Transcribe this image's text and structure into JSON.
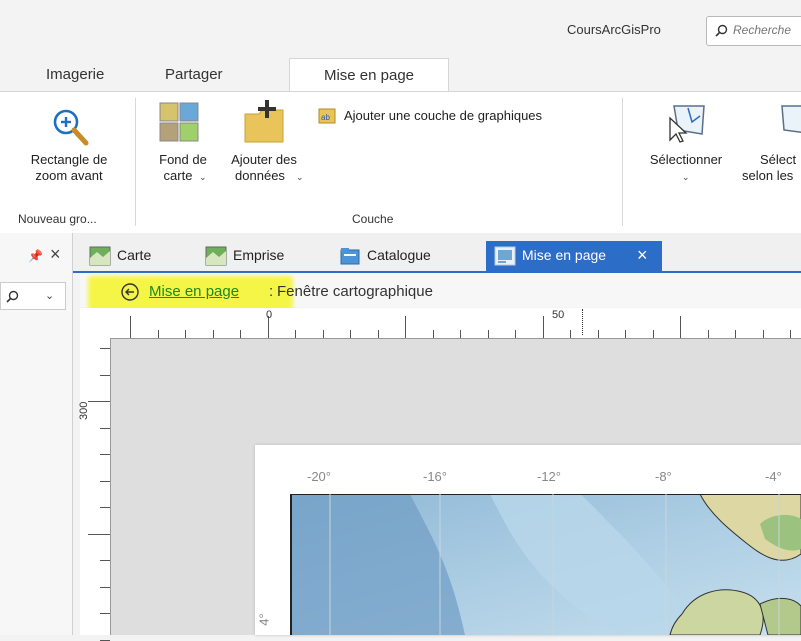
{
  "titlebar": {
    "app_title": "CoursArcGisPro",
    "search_placeholder": "Recherche"
  },
  "ribbon_tabs": [
    "Imagerie",
    "Partager",
    "Mise en page"
  ],
  "ribbon": {
    "zoom_button": {
      "line1": "Rectangle de",
      "line2": "zoom avant"
    },
    "group_nouveau": "Nouveau gro...",
    "fond_button": {
      "line1": "Fond de",
      "line2": "carte"
    },
    "ajouter_button": {
      "line1": "Ajouter des",
      "line2": "données"
    },
    "graphics_layer_button": "Ajouter une couche de graphiques",
    "group_couche": "Couche",
    "select_button": "Sélectionner",
    "select_by_button": {
      "line1": "Sélect",
      "line2": "selon les"
    }
  },
  "doc_tabs": [
    "Carte",
    "Emprise",
    "Catalogue",
    "Mise en page"
  ],
  "breadcrumb": {
    "link": "Mise en page",
    "separator": ":",
    "rest": "Fenêtre cartographique"
  },
  "ruler": {
    "h_labels": [
      "0",
      "50"
    ],
    "v_label": "300"
  },
  "map_grid_labels": [
    "-20°",
    "-16°",
    "-12°",
    "-8°",
    "-4°"
  ],
  "map_side_label": "4°",
  "colors": {
    "accent": "#2b6dc7",
    "highlight": "#f5f529",
    "link": "#1c8a1c"
  }
}
